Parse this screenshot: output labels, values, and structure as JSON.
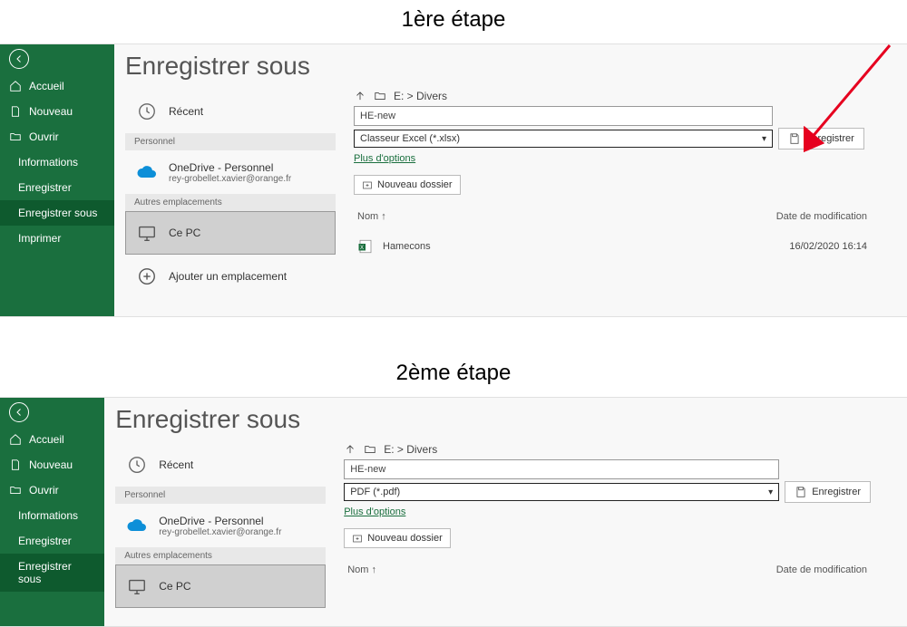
{
  "step1": {
    "title": "1ère étape",
    "main_title": "Enregistrer sous",
    "sidebar": {
      "items": [
        {
          "label": "Accueil"
        },
        {
          "label": "Nouveau"
        },
        {
          "label": "Ouvrir"
        },
        {
          "label": "Informations"
        },
        {
          "label": "Enregistrer"
        },
        {
          "label": "Enregistrer sous"
        },
        {
          "label": "Imprimer"
        }
      ]
    },
    "locations": {
      "recent_label": "Récent",
      "personal_header": "Personnel",
      "onedrive_label": "OneDrive - Personnel",
      "onedrive_sub": "rey-grobellet.xavier@orange.fr",
      "other_header": "Autres emplacements",
      "thispc_label": "Ce PC",
      "addloc_label": "Ajouter un emplacement"
    },
    "right": {
      "path": "E: > Divers",
      "filename": "HE-new",
      "format": "Classeur Excel (*.xlsx)",
      "save_label": "Enregistrer",
      "more_options": "Plus d'options",
      "new_folder": "Nouveau dossier",
      "col_name": "Nom",
      "col_date": "Date de modification",
      "file_name": "Hamecons",
      "file_date": "16/02/2020 16:14"
    }
  },
  "step2": {
    "title": "2ème étape",
    "main_title": "Enregistrer sous",
    "sidebar": {
      "items": [
        {
          "label": "Accueil"
        },
        {
          "label": "Nouveau"
        },
        {
          "label": "Ouvrir"
        },
        {
          "label": "Informations"
        },
        {
          "label": "Enregistrer"
        },
        {
          "label": "Enregistrer sous"
        }
      ]
    },
    "locations": {
      "recent_label": "Récent",
      "personal_header": "Personnel",
      "onedrive_label": "OneDrive - Personnel",
      "onedrive_sub": "rey-grobellet.xavier@orange.fr",
      "other_header": "Autres emplacements",
      "thispc_label": "Ce PC"
    },
    "right": {
      "path": "E: > Divers",
      "filename": "HE-new",
      "format": "PDF (*.pdf)",
      "save_label": "Enregistrer",
      "more_options": "Plus d'options",
      "new_folder": "Nouveau dossier",
      "col_name": "Nom",
      "col_date": "Date de modification"
    }
  }
}
